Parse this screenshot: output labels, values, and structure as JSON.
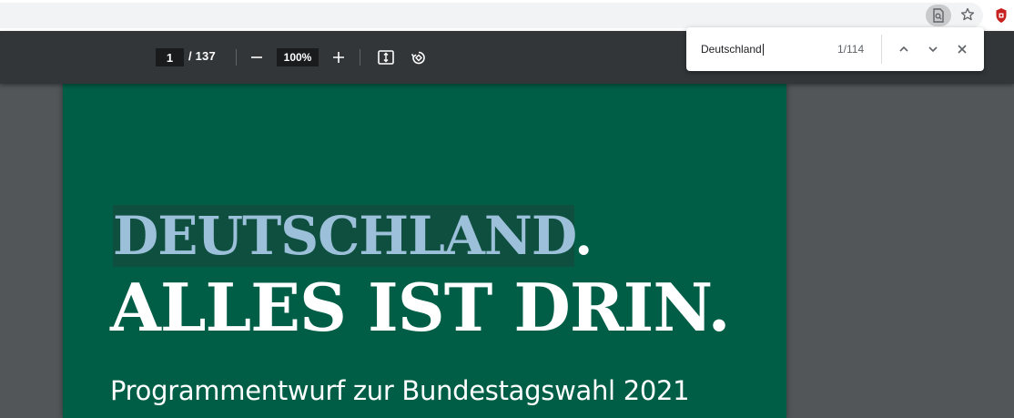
{
  "pdf_toolbar": {
    "current_page": "1",
    "total_pages": "/ 137",
    "zoom": "100%"
  },
  "find_bar": {
    "query": "Deutschland",
    "match_count": "1/114"
  },
  "document": {
    "headline_highlighted": "DEUTSCHLAND",
    "headline_highlight_suffix": ".",
    "headline_line2": "ALLES IST DRIN.",
    "subtitle": "Programmentwurf zur Bundestagswahl 2021"
  },
  "colors": {
    "page_green": "#005e47",
    "headline_blue": "#9cc0d9",
    "toolbar": "#323639",
    "viewer_bg": "#525659"
  },
  "icons": [
    "find-in-page-icon",
    "star-icon",
    "extension-icon",
    "zoom-out-icon",
    "zoom-in-icon",
    "fit-to-page-icon",
    "rotate-icon",
    "chevron-up-icon",
    "chevron-down-icon",
    "close-icon"
  ]
}
